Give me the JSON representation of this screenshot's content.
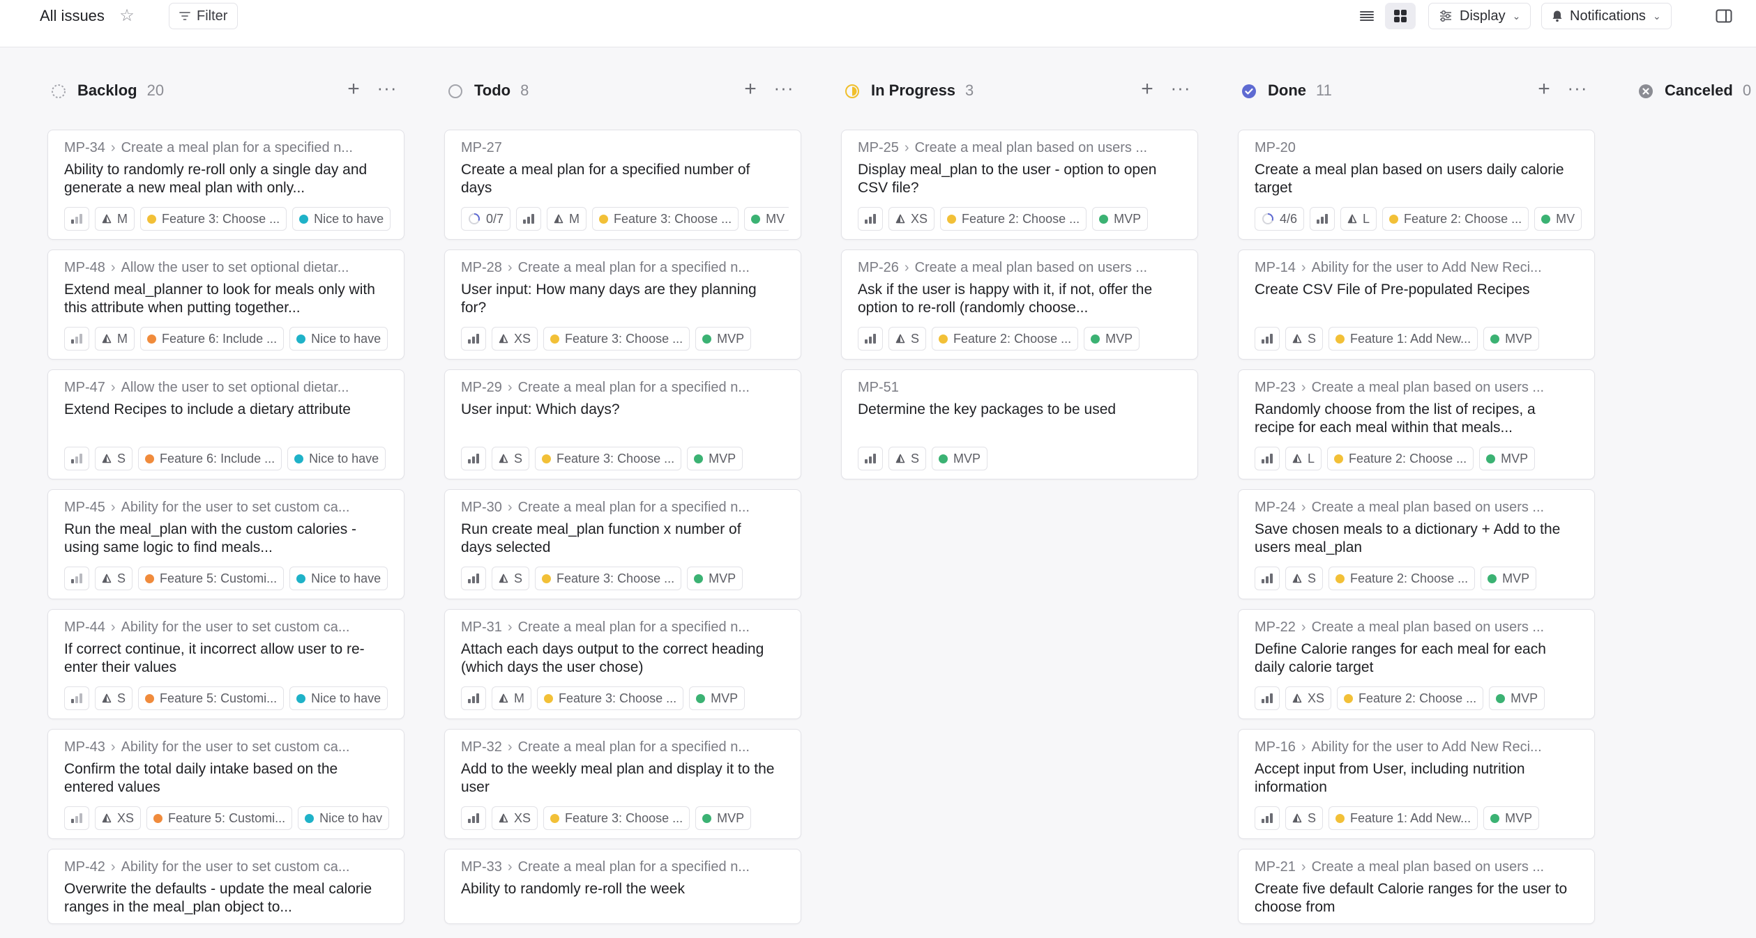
{
  "topbar": {
    "title": "All issues",
    "filter_label": "Filter",
    "display_label": "Display",
    "notifications_label": "Notifications"
  },
  "colors": {
    "feature_yellow": "#f2c037",
    "feature_orange": "#f08b3c",
    "label_teal": "#1fb2c8",
    "label_green": "#3bb273",
    "in_progress": "#f0bf2c",
    "done": "#5e6ad2",
    "canceled": "#8b8c93"
  },
  "columns": [
    {
      "name": "Backlog",
      "count": "20",
      "cards": [
        {
          "id": "MP-34",
          "parent": "Create a meal plan for a specified n...",
          "title": "Ability to randomly re-roll only a single day and generate a new meal plan with only...",
          "est": "M",
          "feature": "Feature 3: Choose ...",
          "feature_color": "yellow",
          "label": "Nice to have",
          "label_color": "teal"
        },
        {
          "id": "MP-48",
          "parent": "Allow the user to set optional dietar...",
          "title": "Extend meal_planner to look for meals only with this attribute when putting together...",
          "est": "M",
          "feature": "Feature 6: Include ...",
          "feature_color": "orange",
          "label": "Nice to have",
          "label_color": "teal"
        },
        {
          "id": "MP-47",
          "parent": "Allow the user to set optional dietar...",
          "title": "Extend Recipes to include a dietary attribute",
          "est": "S",
          "feature": "Feature 6: Include ...",
          "feature_color": "orange",
          "label": "Nice to have",
          "label_color": "teal"
        },
        {
          "id": "MP-45",
          "parent": "Ability for the user to set custom ca...",
          "title": "Run the meal_plan with the custom calories - using same logic to find meals...",
          "est": "S",
          "feature": "Feature 5: Customi...",
          "feature_color": "orange",
          "label": "Nice to have",
          "label_color": "teal"
        },
        {
          "id": "MP-44",
          "parent": "Ability for the user to set custom ca...",
          "title": "If correct continue, it incorrect allow user to re-enter their values",
          "est": "S",
          "feature": "Feature 5: Customi...",
          "feature_color": "orange",
          "label": "Nice to have",
          "label_color": "teal"
        },
        {
          "id": "MP-43",
          "parent": "Ability for the user to set custom ca...",
          "title": "Confirm the total daily intake based on the entered values",
          "est": "XS",
          "feature": "Feature 5: Customi...",
          "feature_color": "orange",
          "label": "Nice to hav",
          "label_color": "teal"
        },
        {
          "id": "MP-42",
          "parent": "Ability for the user to set custom ca...",
          "title": "Overwrite the defaults - update the meal calorie ranges in the meal_plan object to...",
          "est": "",
          "feature": "",
          "feature_color": "",
          "label": "",
          "label_color": ""
        }
      ]
    },
    {
      "name": "Todo",
      "count": "8",
      "cards": [
        {
          "id": "MP-27",
          "parent": "",
          "title": "Create a meal plan for a specified number of days",
          "progress": "0/7",
          "est": "M",
          "feature": "Feature 3: Choose ...",
          "feature_color": "yellow",
          "label": "MV",
          "label_color": "green"
        },
        {
          "id": "MP-28",
          "parent": "Create a meal plan for a specified n...",
          "title": "User input: How many days are they planning for?",
          "est": "XS",
          "feature": "Feature 3: Choose ...",
          "feature_color": "yellow",
          "label": "MVP",
          "label_color": "green"
        },
        {
          "id": "MP-29",
          "parent": "Create a meal plan for a specified n...",
          "title": "User input: Which days?",
          "est": "S",
          "feature": "Feature 3: Choose ...",
          "feature_color": "yellow",
          "label": "MVP",
          "label_color": "green"
        },
        {
          "id": "MP-30",
          "parent": "Create a meal plan for a specified n...",
          "title": "Run create meal_plan function x number of days selected",
          "est": "S",
          "feature": "Feature 3: Choose ...",
          "feature_color": "yellow",
          "label": "MVP",
          "label_color": "green"
        },
        {
          "id": "MP-31",
          "parent": "Create a meal plan for a specified n...",
          "title": "Attach each days output to the correct heading (which days the user chose)",
          "est": "M",
          "feature": "Feature 3: Choose ...",
          "feature_color": "yellow",
          "label": "MVP",
          "label_color": "green"
        },
        {
          "id": "MP-32",
          "parent": "Create a meal plan for a specified n...",
          "title": "Add to the weekly meal plan and display it to the user",
          "est": "XS",
          "feature": "Feature 3: Choose ...",
          "feature_color": "yellow",
          "label": "MVP",
          "label_color": "green"
        },
        {
          "id": "MP-33",
          "parent": "Create a meal plan for a specified n...",
          "title": "Ability to randomly re-roll the week",
          "est": "",
          "feature": "",
          "feature_color": "",
          "label": "",
          "label_color": ""
        }
      ]
    },
    {
      "name": "In Progress",
      "count": "3",
      "cards": [
        {
          "id": "MP-25",
          "parent": "Create a meal plan based on users ...",
          "title": "Display meal_plan to the user - option to open CSV file?",
          "est": "XS",
          "feature": "Feature 2: Choose ...",
          "feature_color": "yellow",
          "label": "MVP",
          "label_color": "green"
        },
        {
          "id": "MP-26",
          "parent": "Create a meal plan based on users ...",
          "title": "Ask if the user is happy with it, if not, offer the option to re-roll (randomly choose...",
          "est": "S",
          "feature": "Feature 2: Choose ...",
          "feature_color": "yellow",
          "label": "MVP",
          "label_color": "green"
        },
        {
          "id": "MP-51",
          "parent": "",
          "title": "Determine the key packages to be used",
          "est": "S",
          "feature": "",
          "feature_color": "",
          "label": "MVP",
          "label_color": "green"
        }
      ]
    },
    {
      "name": "Done",
      "count": "11",
      "cards": [
        {
          "id": "MP-20",
          "parent": "",
          "title": "Create a meal plan based on users daily calorie target",
          "progress": "4/6",
          "est": "L",
          "feature": "Feature 2: Choose ...",
          "feature_color": "yellow",
          "label": "MV",
          "label_color": "green"
        },
        {
          "id": "MP-14",
          "parent": "Ability for the user to Add New Reci...",
          "title": "Create CSV File of Pre-populated Recipes",
          "est": "S",
          "feature": "Feature 1: Add New...",
          "feature_color": "yellow",
          "label": "MVP",
          "label_color": "green"
        },
        {
          "id": "MP-23",
          "parent": "Create a meal plan based on users ...",
          "title": "Randomly choose from the list of recipes, a recipe for each meal within that meals...",
          "est": "L",
          "feature": "Feature 2: Choose ...",
          "feature_color": "yellow",
          "label": "MVP",
          "label_color": "green"
        },
        {
          "id": "MP-24",
          "parent": "Create a meal plan based on users ...",
          "title": "Save chosen meals to a dictionary + Add to the users meal_plan",
          "est": "S",
          "feature": "Feature 2: Choose ...",
          "feature_color": "yellow",
          "label": "MVP",
          "label_color": "green"
        },
        {
          "id": "MP-22",
          "parent": "Create a meal plan based on users ...",
          "title": "Define Calorie ranges for each meal for each daily calorie target",
          "est": "XS",
          "feature": "Feature 2: Choose ...",
          "feature_color": "yellow",
          "label": "MVP",
          "label_color": "green"
        },
        {
          "id": "MP-16",
          "parent": "Ability for the user to Add New Reci...",
          "title": "Accept input from User, including nutrition information",
          "est": "S",
          "feature": "Feature 1: Add New...",
          "feature_color": "yellow",
          "label": "MVP",
          "label_color": "green"
        },
        {
          "id": "MP-21",
          "parent": "Create a meal plan based on users ...",
          "title": "Create five default Calorie ranges for the user to choose from",
          "est": "",
          "feature": "",
          "feature_color": "",
          "label": "",
          "label_color": ""
        }
      ]
    },
    {
      "name": "Canceled",
      "count": "0",
      "cards": []
    }
  ]
}
